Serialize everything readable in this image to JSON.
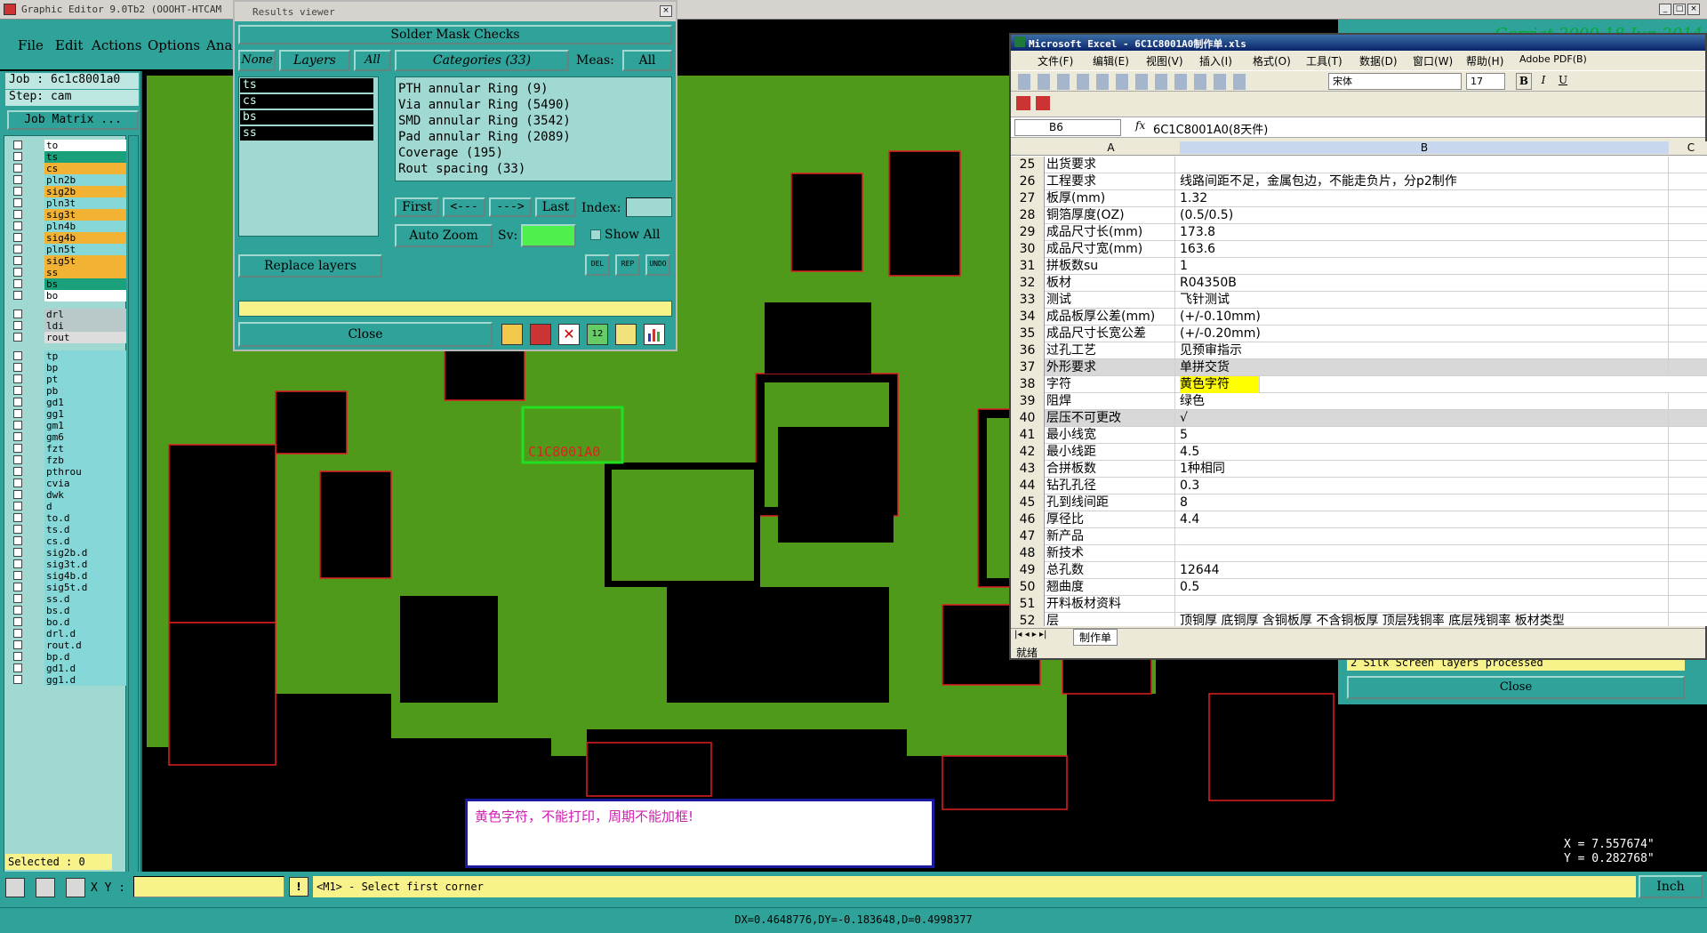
{
  "app": {
    "title": "Graphic Editor 9.0Tb2 (OOOHT-HTCAM",
    "menu": [
      "File",
      "Edit",
      "Actions",
      "Options",
      "Anal"
    ]
  },
  "job": {
    "job_line": "Job : 6c1c8001a0",
    "step_line": "Step: cam",
    "matrix_btn": "Job Matrix ..."
  },
  "layers": [
    {
      "name": "to",
      "color": "#ffffff"
    },
    {
      "name": "ts",
      "color": "#1aa07a"
    },
    {
      "name": "cs",
      "color": "#f2b233"
    },
    {
      "name": "pln2b",
      "color": "#86d7d7"
    },
    {
      "name": "sig2b",
      "color": "#f2b233"
    },
    {
      "name": "pln3t",
      "color": "#86d7d7"
    },
    {
      "name": "sig3t",
      "color": "#f2b233"
    },
    {
      "name": "pln4b",
      "color": "#86d7d7"
    },
    {
      "name": "sig4b",
      "color": "#f2b233"
    },
    {
      "name": "pln5t",
      "color": "#86d7d7"
    },
    {
      "name": "sig5t",
      "color": "#f2b233"
    },
    {
      "name": "ss",
      "color": "#f2b233"
    },
    {
      "name": "bs",
      "color": "#1aa07a"
    },
    {
      "name": "bo",
      "color": "#ffffff"
    },
    {
      "name": "drl",
      "color": "#b9c9c9"
    },
    {
      "name": "ldi",
      "color": "#b9c9c9"
    },
    {
      "name": "rout",
      "color": "#dddddd"
    },
    {
      "name": "tp",
      "color": "#86d7d7"
    },
    {
      "name": "bp",
      "color": "#86d7d7"
    },
    {
      "name": "pt",
      "color": "#86d7d7"
    },
    {
      "name": "pb",
      "color": "#86d7d7"
    },
    {
      "name": "gd1",
      "color": "#86d7d7"
    },
    {
      "name": "gg1",
      "color": "#86d7d7"
    },
    {
      "name": "gm1",
      "color": "#86d7d7"
    },
    {
      "name": "gm6",
      "color": "#86d7d7"
    },
    {
      "name": "fzt",
      "color": "#86d7d7"
    },
    {
      "name": "fzb",
      "color": "#86d7d7"
    },
    {
      "name": "pthrou",
      "color": "#86d7d7"
    },
    {
      "name": "cvia",
      "color": "#86d7d7"
    },
    {
      "name": "dwk",
      "color": "#86d7d7"
    },
    {
      "name": "d",
      "color": "#86d7d7"
    },
    {
      "name": "to.d",
      "color": "#86d7d7"
    },
    {
      "name": "ts.d",
      "color": "#86d7d7"
    },
    {
      "name": "cs.d",
      "color": "#86d7d7"
    },
    {
      "name": "sig2b.d",
      "color": "#86d7d7"
    },
    {
      "name": "sig3t.d",
      "color": "#86d7d7"
    },
    {
      "name": "sig4b.d",
      "color": "#86d7d7"
    },
    {
      "name": "sig5t.d",
      "color": "#86d7d7"
    },
    {
      "name": "ss.d",
      "color": "#86d7d7"
    },
    {
      "name": "bs.d",
      "color": "#86d7d7"
    },
    {
      "name": "bo.d",
      "color": "#86d7d7"
    },
    {
      "name": "drl.d",
      "color": "#86d7d7"
    },
    {
      "name": "rout.d",
      "color": "#86d7d7"
    },
    {
      "name": "bp.d",
      "color": "#86d7d7"
    },
    {
      "name": "gd1.d",
      "color": "#86d7d7"
    },
    {
      "name": "gg1.d",
      "color": "#86d7d7"
    }
  ],
  "selected": "Selected : 0",
  "results": {
    "title": "Results viewer",
    "header": "Solder Mask Checks",
    "none_btn": "None",
    "layers_btn": "Layers",
    "all_btn": "All",
    "categories_btn": "Categories (33)",
    "meas_label": "Meas:",
    "meas_value": "All",
    "layer_list": [
      "ts",
      "cs",
      "bs",
      "ss"
    ],
    "categories": [
      "PTH annular Ring (9)",
      "Via annular Ring (5490)",
      "SMD annular Ring (3542)",
      "Pad annular Ring (2089)",
      "Coverage (195)",
      "Rout spacing (33)"
    ],
    "first": "First",
    "prev": "<---",
    "next": "--->",
    "last": "Last",
    "index_label": "Index:",
    "auto_zoom": "Auto Zoom",
    "sv_label": "Sv:",
    "show_all": "Show All",
    "replace_layers": "Replace layers",
    "close": "Close",
    "small_btns": [
      "DEL",
      "REP",
      "UNDO"
    ]
  },
  "excel": {
    "title": "Microsoft Excel - 6C1C8001A0制作单.xls",
    "menu": [
      "文件(F)",
      "编辑(E)",
      "视图(V)",
      "插入(I)",
      "格式(O)",
      "工具(T)",
      "数据(D)",
      "窗口(W)",
      "帮助(H)",
      "Adobe PDF(B)"
    ],
    "font": "宋体",
    "size": "17",
    "cellref": "B6",
    "formula": "6C1C8001A0(8天件)",
    "cols": [
      "A",
      "B",
      "C"
    ],
    "rows": [
      {
        "n": "25",
        "a": "出货要求",
        "b": ""
      },
      {
        "n": "26",
        "a": "工程要求",
        "b": "线路间距不足，金属包边，不能走负片，分p2制作"
      },
      {
        "n": "27",
        "a": "板厚(mm)",
        "b": "1.32"
      },
      {
        "n": "28",
        "a": "铜箔厚度(OZ)",
        "b": "(0.5/0.5)"
      },
      {
        "n": "29",
        "a": "成品尺寸长(mm)",
        "b": "173.8"
      },
      {
        "n": "30",
        "a": "成品尺寸宽(mm)",
        "b": "163.6"
      },
      {
        "n": "31",
        "a": "拼板数su",
        "b": "1"
      },
      {
        "n": "32",
        "a": "板材",
        "b": "R04350B"
      },
      {
        "n": "33",
        "a": "测试",
        "b": "飞针测试"
      },
      {
        "n": "34",
        "a": "成品板厚公差(mm)",
        "b": "(+/-0.10mm)"
      },
      {
        "n": "35",
        "a": "成品尺寸长宽公差",
        "b": "(+/-0.20mm)"
      },
      {
        "n": "36",
        "a": "过孔工艺",
        "b": "见预审指示"
      },
      {
        "n": "37",
        "a": "外形要求",
        "b": "单拼交货"
      },
      {
        "n": "38",
        "a": "字符",
        "b": "黄色字符"
      },
      {
        "n": "39",
        "a": "阻焊",
        "b": "绿色"
      },
      {
        "n": "40",
        "a": "层压不可更改",
        "b": "√"
      },
      {
        "n": "41",
        "a": "最小线宽",
        "b": "5"
      },
      {
        "n": "42",
        "a": "最小线距",
        "b": "4.5"
      },
      {
        "n": "43",
        "a": "合拼板数",
        "b": "1种相同"
      },
      {
        "n": "44",
        "a": "钻孔孔径",
        "b": "0.3"
      },
      {
        "n": "45",
        "a": "孔到线间距",
        "b": "8"
      },
      {
        "n": "46",
        "a": "厚径比",
        "b": "4.4"
      },
      {
        "n": "47",
        "a": "新产品",
        "b": ""
      },
      {
        "n": "48",
        "a": "新技术",
        "b": ""
      },
      {
        "n": "49",
        "a": "总孔数",
        "b": "12644"
      },
      {
        "n": "50",
        "a": "翘曲度",
        "b": "0.5"
      },
      {
        "n": "51",
        "a": "开料板材资料",
        "b": ""
      },
      {
        "n": "52",
        "a": "层",
        "b": "顶铜厚 底铜厚 含铜板厚 不含铜板厚 顶层残铜率 底层残铜率 板材类型"
      }
    ],
    "sheet_tab": "制作单",
    "status": "就绪"
  },
  "right_dialog": {
    "processed": "2 Silk Screen layers processed",
    "close": "Close",
    "header_text": "Gerriat 2009 18 Jun 2014"
  },
  "board": {
    "label": "C1C8001A0"
  },
  "note": "黄色字符，不能打印，周期不能加框!",
  "coords": {
    "x": "X = 7.557674\"",
    "y": "Y = 0.282768\""
  },
  "bottom": {
    "xy_label": "X Y :",
    "prompt": "<M1> - Select first corner",
    "units": "Inch"
  },
  "status": "DX=0.4648776,DY=-0.183648,D=0.4998377"
}
